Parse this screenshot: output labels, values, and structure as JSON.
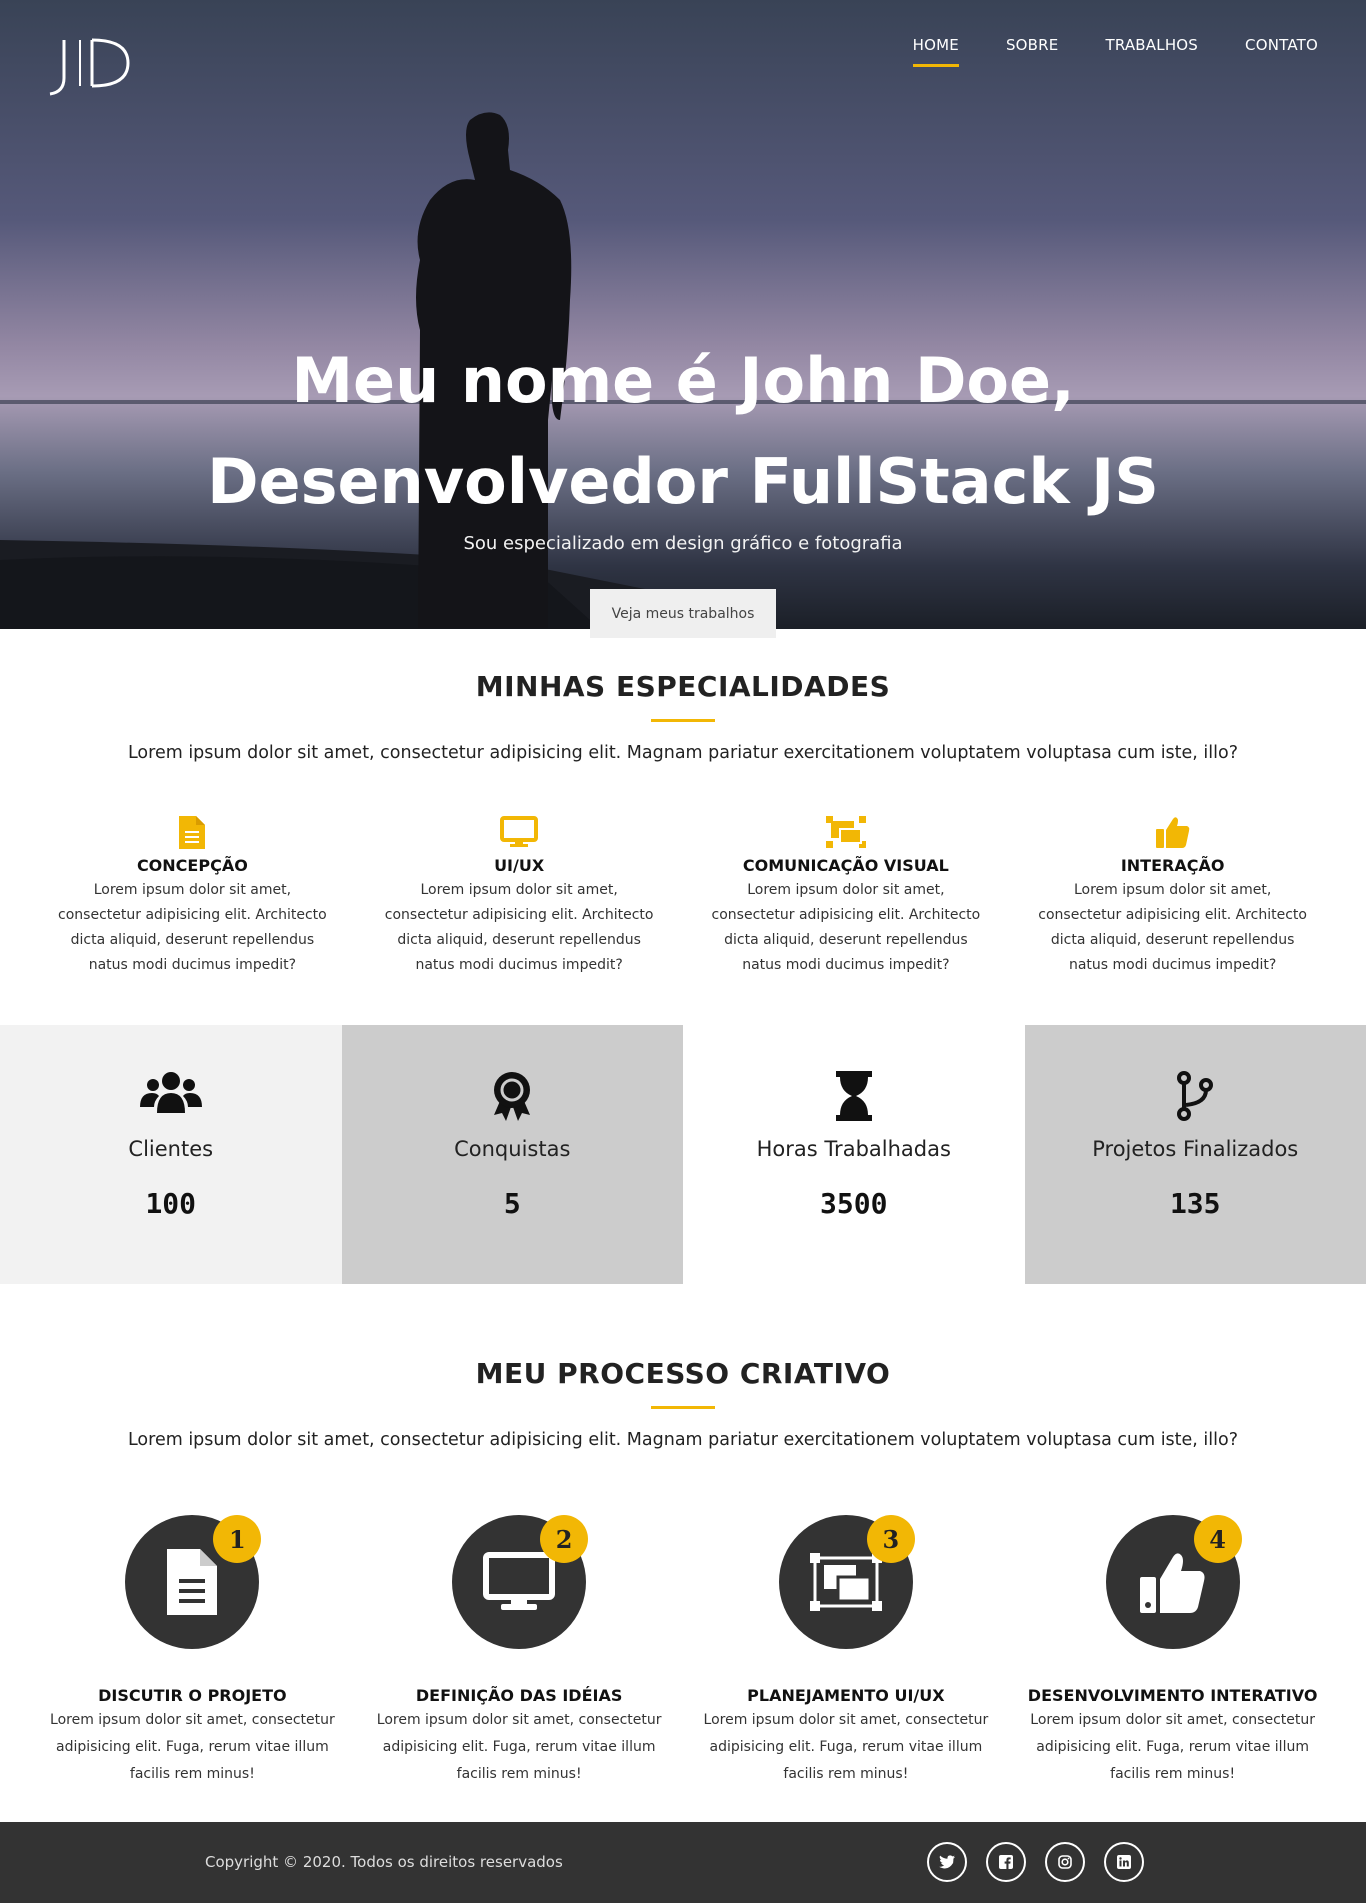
{
  "nav": {
    "items": [
      {
        "label": "HOME"
      },
      {
        "label": "SOBRE"
      },
      {
        "label": "TRABALHOS"
      },
      {
        "label": "CONTATO"
      }
    ]
  },
  "hero": {
    "title": "Meu nome é John Doe, Desenvolvedor FullStack JS",
    "subtitle": "Sou especializado em design gráfico e fotografia",
    "button": "Veja meus trabalhos"
  },
  "specialties": {
    "title": "MINHAS ESPECIALIDADES",
    "description": "Lorem ipsum dolor sit amet, consectetur adipisicing elit. Magnam pariatur exercitationem voluptatem voluptasa cum iste, illo?",
    "items": [
      {
        "title": "CONCEPÇÃO",
        "text": "Lorem ipsum dolor sit amet, consectetur adipisicing elit. Architecto dicta aliquid, deserunt repellendus natus modi ducimus impedit?",
        "icon": "document-icon"
      },
      {
        "title": "UI/UX",
        "text": "Lorem ipsum dolor sit amet, consectetur adipisicing elit. Architecto dicta aliquid, deserunt repellendus natus modi ducimus impedit?",
        "icon": "monitor-icon"
      },
      {
        "title": "COMUNICAÇÃO VISUAL",
        "text": "Lorem ipsum dolor sit amet, consectetur adipisicing elit. Architecto dicta aliquid, deserunt repellendus natus modi ducimus impedit?",
        "icon": "object-group-icon"
      },
      {
        "title": "INTERAÇÃO",
        "text": "Lorem ipsum dolor sit amet, consectetur adipisicing elit. Architecto dicta aliquid, deserunt repellendus natus modi ducimus impedit?",
        "icon": "thumbs-up-icon"
      }
    ]
  },
  "stats": {
    "items": [
      {
        "label": "Clientes",
        "value": "100",
        "icon": "users-icon"
      },
      {
        "label": "Conquistas",
        "value": "5",
        "icon": "award-icon"
      },
      {
        "label": "Horas Trabalhadas",
        "value": "3500",
        "icon": "hourglass-icon"
      },
      {
        "label": "Projetos Finalizados",
        "value": "135",
        "icon": "code-branch-icon"
      }
    ]
  },
  "process": {
    "title": "MEU PROCESSO CRIATIVO",
    "description": "Lorem ipsum dolor sit amet, consectetur adipisicing elit. Magnam pariatur exercitationem voluptatem voluptasa cum iste, illo?",
    "items": [
      {
        "number": "1",
        "title": "DISCUTIR O PROJETO",
        "text": "Lorem ipsum dolor sit amet, consectetur adipisicing elit. Fuga, rerum vitae illum facilis rem minus!",
        "icon": "document-icon"
      },
      {
        "number": "2",
        "title": "DEFINIÇÃO DAS IDÉIAS",
        "text": "Lorem ipsum dolor sit amet, consectetur adipisicing elit. Fuga, rerum vitae illum facilis rem minus!",
        "icon": "monitor-icon"
      },
      {
        "number": "3",
        "title": "PLANEJAMENTO UI/UX",
        "text": "Lorem ipsum dolor sit amet, consectetur adipisicing elit. Fuga, rerum vitae illum facilis rem minus!",
        "icon": "object-group-icon"
      },
      {
        "number": "4",
        "title": "DESENVOLVIMENTO INTERATIVO",
        "text": "Lorem ipsum dolor sit amet, consectetur adipisicing elit. Fuga, rerum vitae illum facilis rem minus!",
        "icon": "thumbs-up-icon"
      }
    ]
  },
  "footer": {
    "copyright": "Copyright © 2020. Todos os direitos reservados",
    "socials": [
      "twitter-icon",
      "facebook-icon",
      "instagram-icon",
      "linkedin-icon"
    ]
  },
  "colors": {
    "accent": "#f2b705",
    "dark": "#333333",
    "stat_light": "#f2f2f2",
    "stat_dark": "#cccccc"
  }
}
